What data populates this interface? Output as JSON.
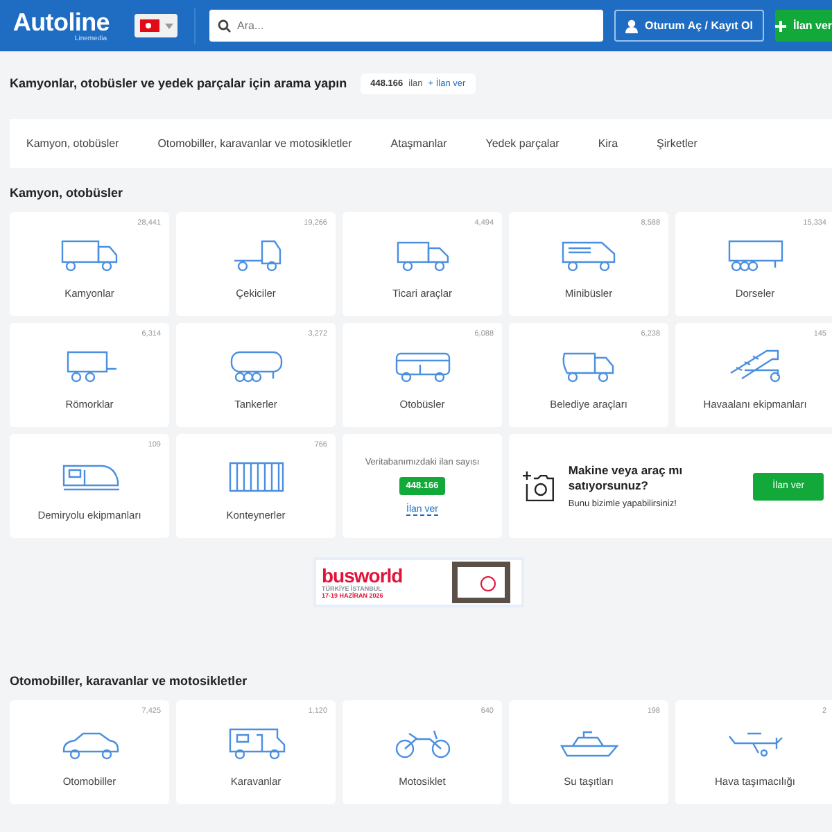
{
  "header": {
    "logo": "Autoline",
    "logo_sub": "Linemedia",
    "search_placeholder": "Ara...",
    "login_button": "Oturum Aç / Kayıt Ol",
    "post_button": "İlan ver"
  },
  "intro": {
    "title": "Kamyonlar, otobüsler ve yedek parçalar için arama yapın",
    "count": "448.166",
    "count_unit": "ilan",
    "link": "+ İlan ver"
  },
  "nav": [
    "Kamyon, otobüsler",
    "Otomobiller, karavanlar ve motosikletler",
    "Ataşmanlar",
    "Yedek parçalar",
    "Kira",
    "Şirketler"
  ],
  "sections": [
    {
      "title": "Kamyon, otobüsler",
      "cards": [
        {
          "label": "Kamyonlar",
          "count": "28,441"
        },
        {
          "label": "Çekiciler",
          "count": "19,266"
        },
        {
          "label": "Ticari araçlar",
          "count": "4,494"
        },
        {
          "label": "Minibüsler",
          "count": "8,588"
        },
        {
          "label": "Dorseler",
          "count": "15,334"
        },
        {
          "label": "Römorklar",
          "count": "6,314"
        },
        {
          "label": "Tankerler",
          "count": "3,272"
        },
        {
          "label": "Otobüsler",
          "count": "6,088"
        },
        {
          "label": "Belediye araçları",
          "count": "6,238"
        },
        {
          "label": "Havaalanı ekipmanları",
          "count": "145"
        },
        {
          "label": "Demiryolu ekipmanları",
          "count": "109"
        },
        {
          "label": "Konteynerler",
          "count": "766"
        }
      ],
      "stats": {
        "caption": "Veritabanımızdaki ilan sayısı",
        "count": "448.166",
        "link": "İlan ver"
      },
      "promo": {
        "title": "Makine veya araç mı satıyorsunuz?",
        "subtitle": "Bunu bizimle yapabilirsiniz!",
        "button": "İlan ver"
      }
    },
    {
      "title": "Otomobiller, karavanlar ve motosikletler",
      "cards": [
        {
          "label": "Otomobiller",
          "count": "7,425"
        },
        {
          "label": "Karavanlar",
          "count": "1,120"
        },
        {
          "label": "Motosiklet",
          "count": "640"
        },
        {
          "label": "Su taşıtları",
          "count": "198"
        },
        {
          "label": "Hava taşımacılığı",
          "count": "2"
        }
      ]
    }
  ],
  "banner": {
    "brand": "busworld",
    "line_1": "TÜRKİYE İSTANBUL",
    "line_2": "17-19 HAZİRAN 2026"
  }
}
